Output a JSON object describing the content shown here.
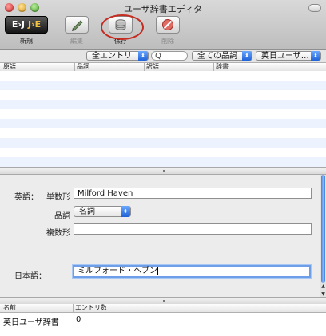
{
  "window": {
    "title": "ユーザ辞書エディタ"
  },
  "toolbar": {
    "ej_label": "E›J",
    "je_label": "J›E",
    "new_label": "新規",
    "edit_label": "編集",
    "save_label": "保存",
    "delete_label": "削除"
  },
  "filter": {
    "entries": "全エントリ",
    "search_placeholder": "Q",
    "pos": "全ての品詞",
    "dict": "英日ユーザ…"
  },
  "columns": {
    "headword": "原語",
    "pos": "品詞",
    "translation": "訳語",
    "dictionary": "辞書"
  },
  "detail": {
    "english_label": "英語：",
    "singular_label": "単数形",
    "singular_value": "Milford Haven",
    "pos_label": "品詞",
    "pos_value": "名詞",
    "plural_label": "複数形",
    "plural_value": "",
    "japanese_label": "日本語：",
    "japanese_value": "ミルフォード・ヘブン"
  },
  "dict_table": {
    "name_header": "名前",
    "count_header": "エントリ数",
    "rows": [
      {
        "name": "英日ユーザ辞書",
        "count": "0"
      }
    ]
  }
}
